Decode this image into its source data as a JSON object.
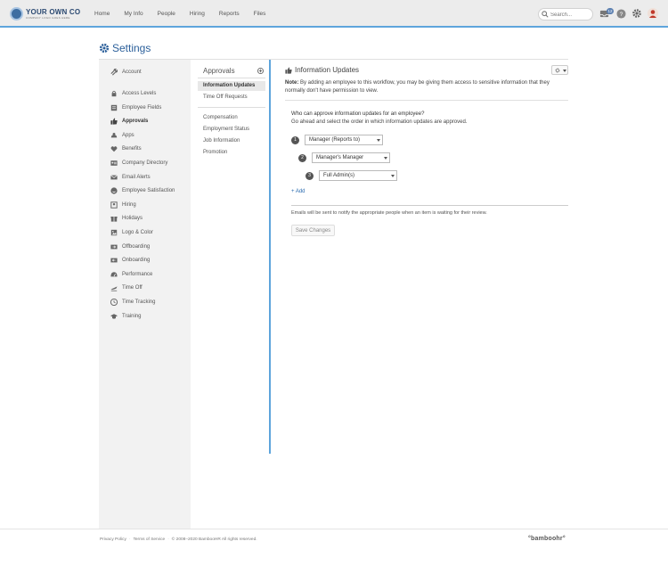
{
  "topbar": {
    "logo_main": "YOUR OWN CO",
    "logo_sub": "COMPANY LOGO GOES HERE",
    "nav": [
      "Home",
      "My Info",
      "People",
      "Hiring",
      "Reports",
      "Files"
    ],
    "search_placeholder": "Search...",
    "inbox_badge": "12",
    "accent_color": "#5ea5dc"
  },
  "page": {
    "title": "Settings"
  },
  "left_nav": {
    "items": [
      {
        "label": "Account",
        "icon": "wrench-icon"
      },
      {
        "label": "Access Levels",
        "icon": "lock-icon"
      },
      {
        "label": "Employee Fields",
        "icon": "list-icon"
      },
      {
        "label": "Approvals",
        "icon": "thumbs-up-icon",
        "active": true
      },
      {
        "label": "Apps",
        "icon": "apps-icon"
      },
      {
        "label": "Benefits",
        "icon": "heart-icon"
      },
      {
        "label": "Company Directory",
        "icon": "directory-icon"
      },
      {
        "label": "Email Alerts",
        "icon": "envelope-icon"
      },
      {
        "label": "Employee Satisfaction",
        "icon": "smile-icon"
      },
      {
        "label": "Hiring",
        "icon": "hiring-icon"
      },
      {
        "label": "Holidays",
        "icon": "gift-icon"
      },
      {
        "label": "Logo & Color",
        "icon": "palette-icon"
      },
      {
        "label": "Offboarding",
        "icon": "offboarding-icon"
      },
      {
        "label": "Onboarding",
        "icon": "onboarding-icon"
      },
      {
        "label": "Performance",
        "icon": "gauge-icon"
      },
      {
        "label": "Time Off",
        "icon": "plane-icon"
      },
      {
        "label": "Time Tracking",
        "icon": "clock-icon"
      },
      {
        "label": "Training",
        "icon": "graduation-icon"
      }
    ]
  },
  "approvals_nav": {
    "heading": "Approvals",
    "group1": [
      "Information Updates",
      "Time Off Requests"
    ],
    "group2": [
      "Compensation",
      "Employment Status",
      "Job Information",
      "Promotion"
    ]
  },
  "main": {
    "title": "Information Updates",
    "note_label": "Note:",
    "note_text": "By adding an employee to this workflow, you may be giving them access to sensitive information that they normally don't have permission to view.",
    "who_question": "Who can approve information updates for an employee?",
    "who_hint": "Go ahead and select the order in which information updates are approved.",
    "steps": [
      {
        "num": "1",
        "value": "Manager (Reports to)"
      },
      {
        "num": "2",
        "value": "Manager's Manager"
      },
      {
        "num": "3",
        "value": "Full Admin(s)"
      }
    ],
    "add_label": "+ Add",
    "emails_text": "Emails will be sent to notify the appropriate people when an item is waiting for their review.",
    "save_label": "Save Changes"
  },
  "footer": {
    "privacy": "Privacy Policy",
    "terms": "Terms of Service",
    "copyright": "© 2008–2020 BambooHR All rights reserved.",
    "brand": "°bamboohr°"
  }
}
